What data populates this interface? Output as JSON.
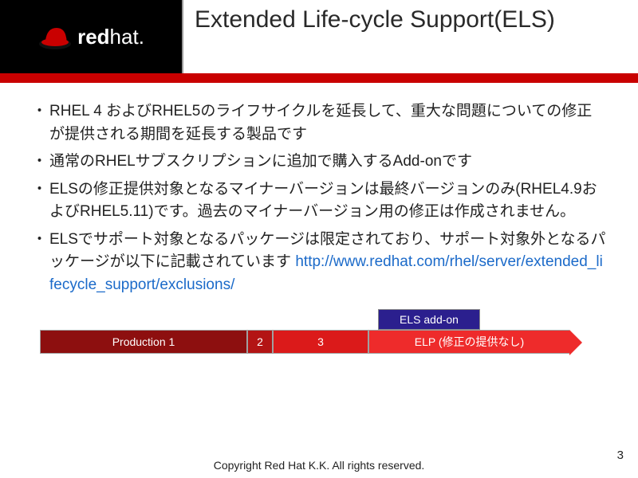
{
  "header": {
    "logo_bold": "red",
    "logo_thin": "hat.",
    "title": "Extended Life-cycle Support(ELS)"
  },
  "bullets": [
    {
      "text": "RHEL 4 およびRHEL5のライフサイクルを延長して、重大な問題についての修正が提供される期間を延長する製品です"
    },
    {
      "text": "通常のRHELサブスクリプションに追加で購入するAdd-onです"
    },
    {
      "text": "ELSの修正提供対象となるマイナーバージョンは最終バージョンのみ(RHEL4.9およびRHEL5.11)です。過去のマイナーバージョン用の修正は作成されません。"
    },
    {
      "text": "ELSでサポート対象となるパッケージは限定されており、サポート対象外となるパッケージが以下に記載されています",
      "link": "http://www.redhat.com/rhel/server/extended_lifecycle_support/exclusions/"
    }
  ],
  "diagram": {
    "addon_label": "ELS add-on",
    "seg_prod1": "Production 1",
    "seg_2": "2",
    "seg_3": "3",
    "seg_elp": "ELP (修正の提供なし)"
  },
  "footer": {
    "copyright": "Copyright Red Hat K.K. All rights reserved.",
    "page": "3"
  }
}
